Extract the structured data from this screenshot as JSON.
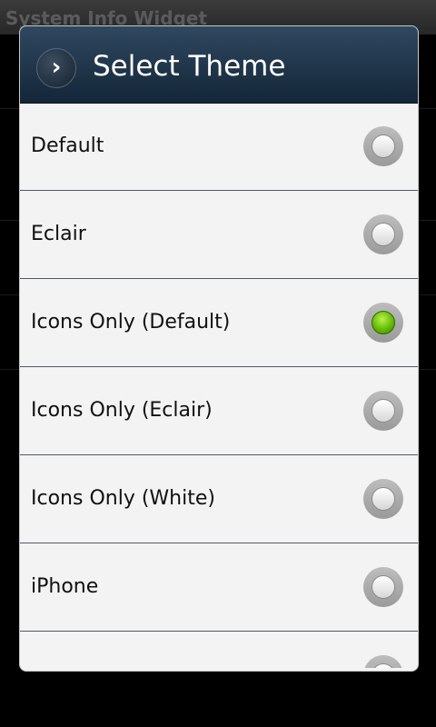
{
  "background": {
    "app_title": "System Info Widget"
  },
  "dialog": {
    "title": "Select Theme",
    "header_icon": "chevron-right-icon",
    "options": [
      {
        "label": "Default",
        "selected": false
      },
      {
        "label": "Eclair",
        "selected": false
      },
      {
        "label": "Icons Only (Default)",
        "selected": true
      },
      {
        "label": "Icons Only (Eclair)",
        "selected": false
      },
      {
        "label": "Icons Only (White)",
        "selected": false
      },
      {
        "label": "iPhone",
        "selected": false
      },
      {
        "label": "",
        "selected": false
      }
    ]
  },
  "colors": {
    "selected_radio": "#66bb00",
    "header": "#1f3347"
  }
}
